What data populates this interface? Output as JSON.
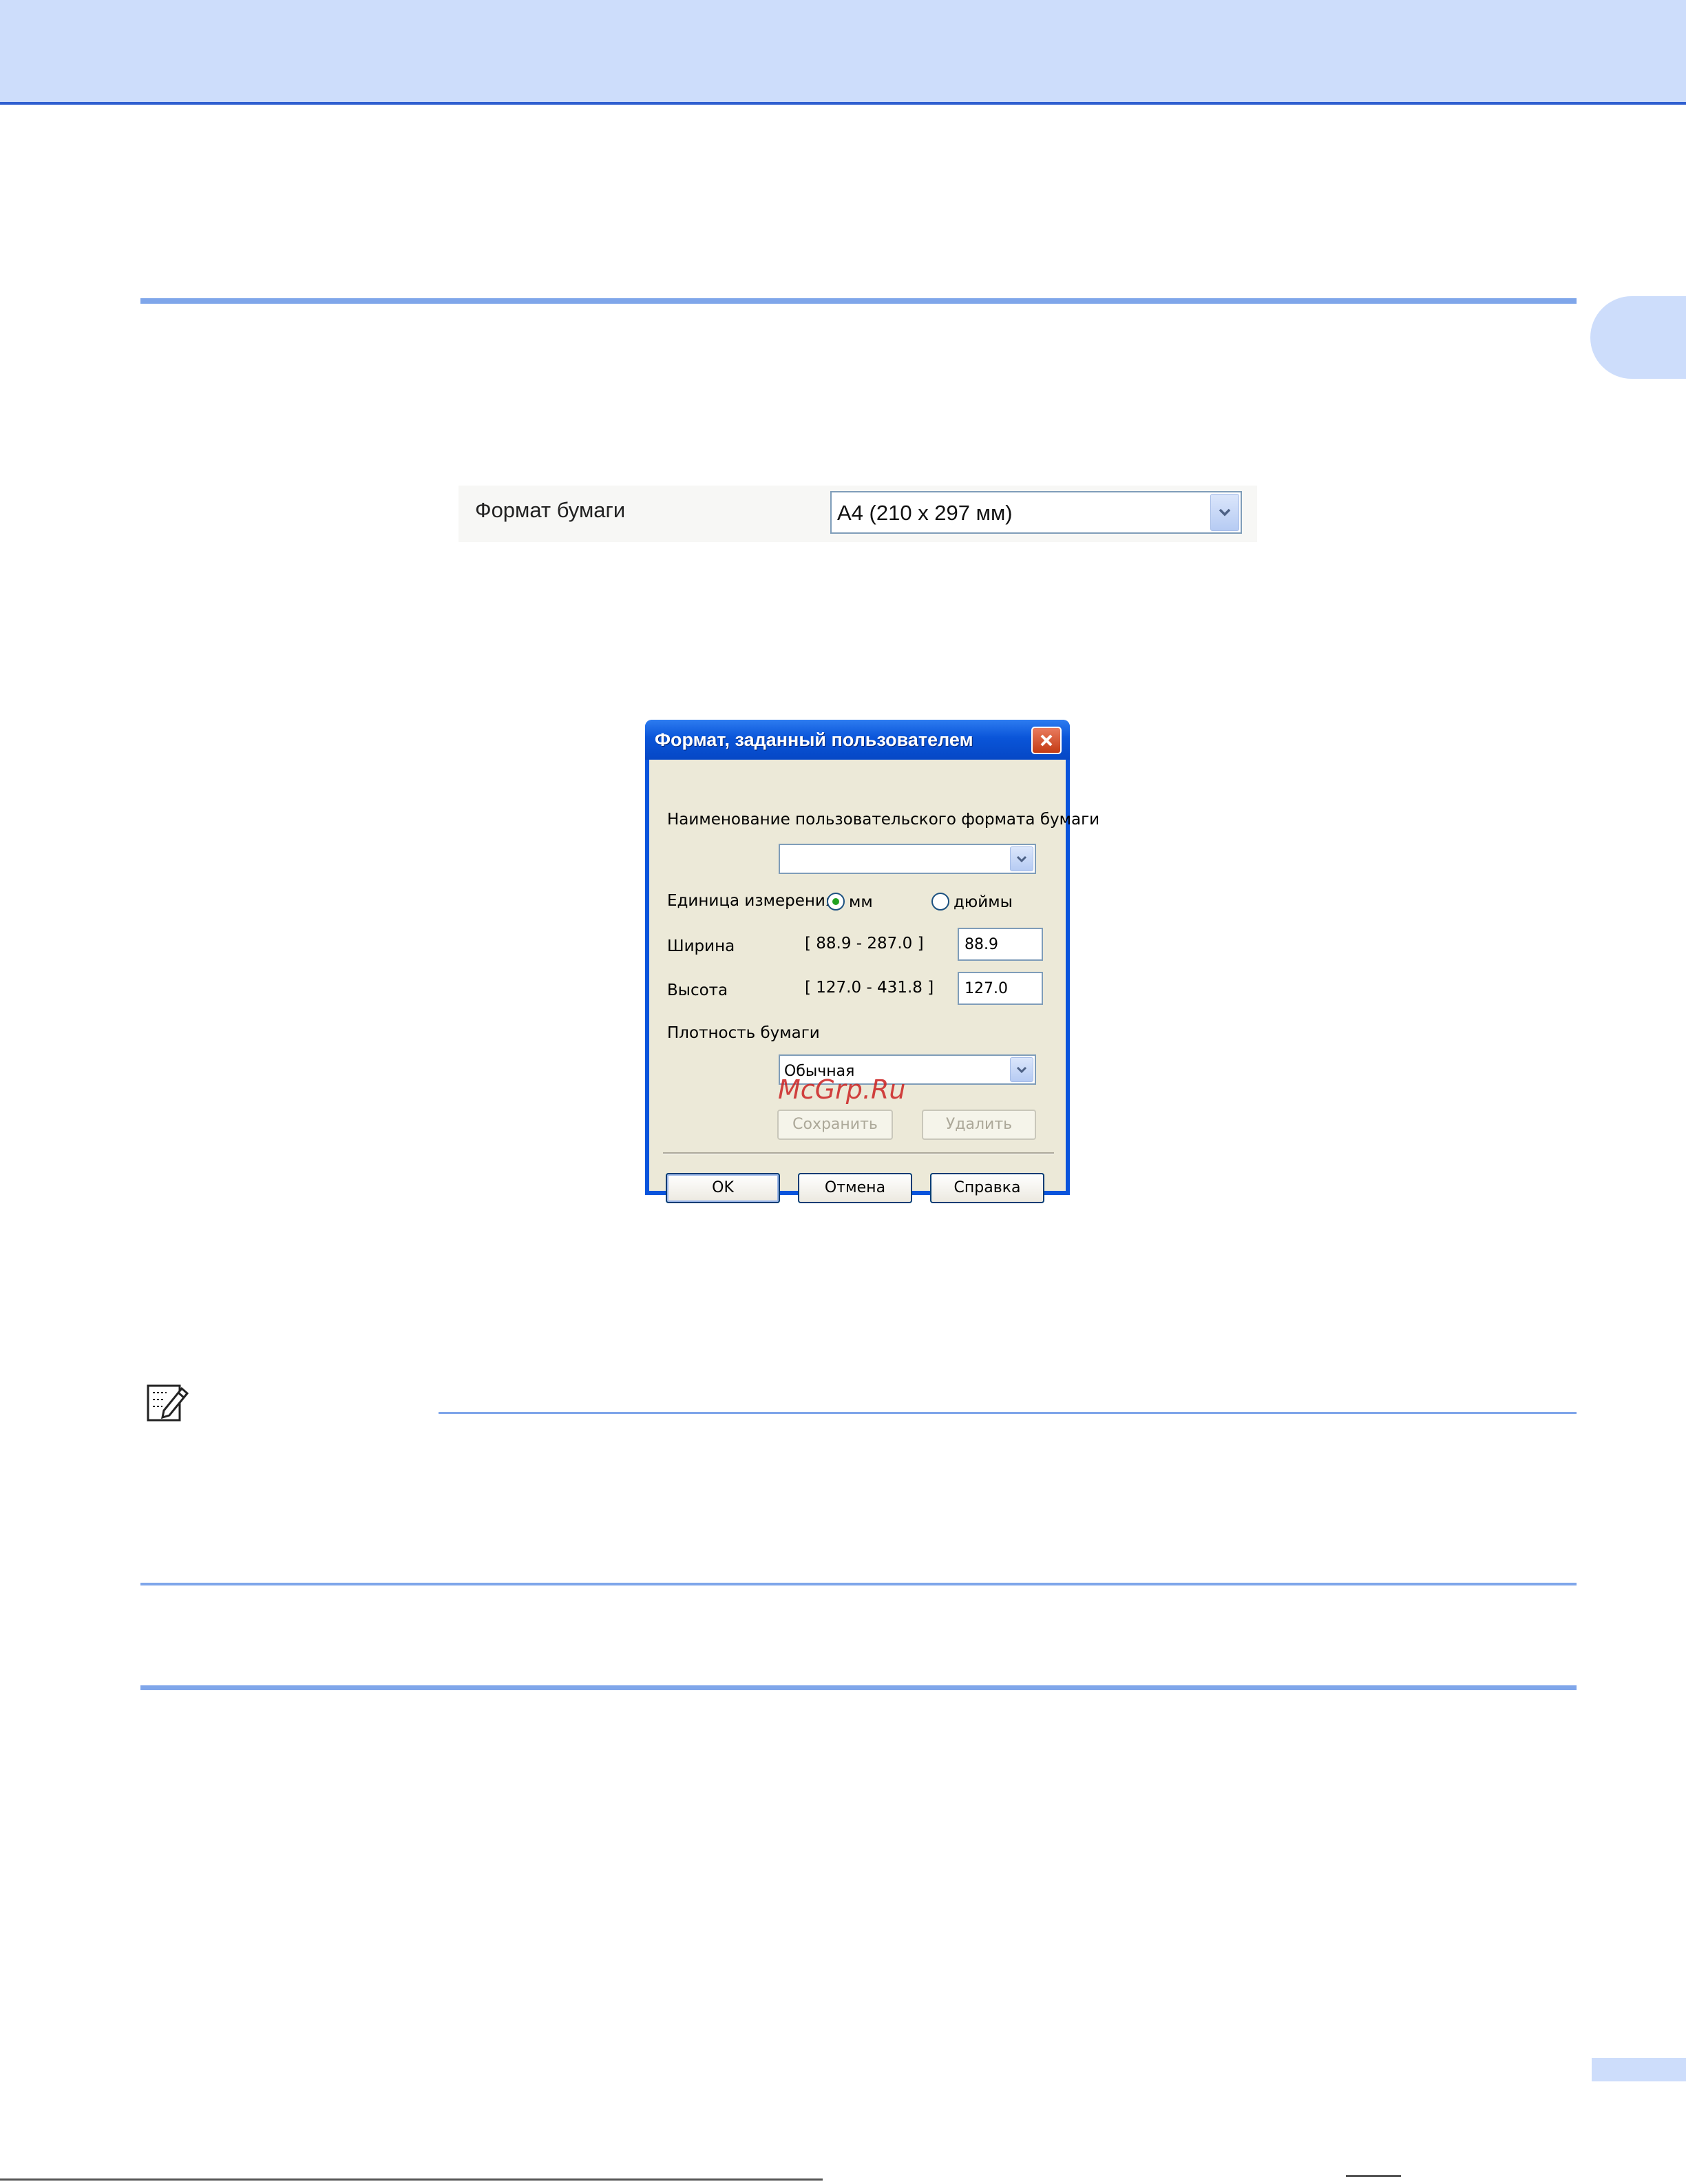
{
  "paper_size": {
    "label": "Формат бумаги",
    "value": "A4 (210 x 297 мм)"
  },
  "dialog": {
    "title": "Формат, заданный пользователем",
    "name_label": "Наименование пользовательского формата бумаги",
    "name_value": "",
    "units_label": "Единица измерения",
    "unit_mm": "мм",
    "unit_inches": "дюймы",
    "selected_unit": "мм",
    "width_label": "Ширина",
    "width_range": "[ 88.9 - 287.0 ]",
    "width_value": "88.9",
    "height_label": "Высота",
    "height_range": "[ 127.0 - 431.8 ]",
    "height_value": "127.0",
    "density_label": "Плотность бумаги",
    "density_value": "Обычная",
    "save_label": "Сохранить",
    "delete_label": "Удалить",
    "ok_label": "OK",
    "cancel_label": "Отмена",
    "help_label": "Справка"
  },
  "watermark": "McGrp.Ru",
  "icons": {
    "dropdown": "chevron-down-icon",
    "close": "close-icon",
    "note": "note-pencil-icon"
  },
  "colors": {
    "header_band": "#cdddfb",
    "rule": "#7fa6ea",
    "title_bar": "#0a55d9",
    "dialog_body": "#ece9d8"
  }
}
